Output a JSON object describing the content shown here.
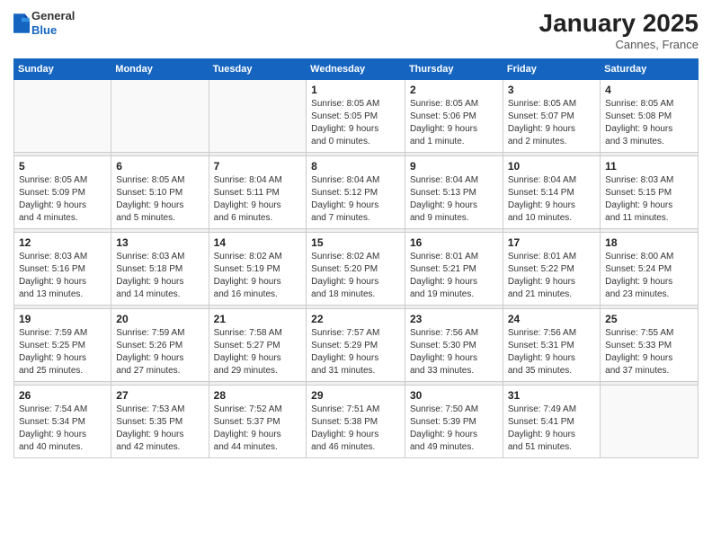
{
  "header": {
    "logo": {
      "general": "General",
      "blue": "Blue"
    },
    "title": "January 2025",
    "location": "Cannes, France"
  },
  "weekdays": [
    "Sunday",
    "Monday",
    "Tuesday",
    "Wednesday",
    "Thursday",
    "Friday",
    "Saturday"
  ],
  "weeks": [
    {
      "days": [
        {
          "number": "",
          "info": ""
        },
        {
          "number": "",
          "info": ""
        },
        {
          "number": "",
          "info": ""
        },
        {
          "number": "1",
          "info": "Sunrise: 8:05 AM\nSunset: 5:05 PM\nDaylight: 9 hours\nand 0 minutes."
        },
        {
          "number": "2",
          "info": "Sunrise: 8:05 AM\nSunset: 5:06 PM\nDaylight: 9 hours\nand 1 minute."
        },
        {
          "number": "3",
          "info": "Sunrise: 8:05 AM\nSunset: 5:07 PM\nDaylight: 9 hours\nand 2 minutes."
        },
        {
          "number": "4",
          "info": "Sunrise: 8:05 AM\nSunset: 5:08 PM\nDaylight: 9 hours\nand 3 minutes."
        }
      ]
    },
    {
      "days": [
        {
          "number": "5",
          "info": "Sunrise: 8:05 AM\nSunset: 5:09 PM\nDaylight: 9 hours\nand 4 minutes."
        },
        {
          "number": "6",
          "info": "Sunrise: 8:05 AM\nSunset: 5:10 PM\nDaylight: 9 hours\nand 5 minutes."
        },
        {
          "number": "7",
          "info": "Sunrise: 8:04 AM\nSunset: 5:11 PM\nDaylight: 9 hours\nand 6 minutes."
        },
        {
          "number": "8",
          "info": "Sunrise: 8:04 AM\nSunset: 5:12 PM\nDaylight: 9 hours\nand 7 minutes."
        },
        {
          "number": "9",
          "info": "Sunrise: 8:04 AM\nSunset: 5:13 PM\nDaylight: 9 hours\nand 9 minutes."
        },
        {
          "number": "10",
          "info": "Sunrise: 8:04 AM\nSunset: 5:14 PM\nDaylight: 9 hours\nand 10 minutes."
        },
        {
          "number": "11",
          "info": "Sunrise: 8:03 AM\nSunset: 5:15 PM\nDaylight: 9 hours\nand 11 minutes."
        }
      ]
    },
    {
      "days": [
        {
          "number": "12",
          "info": "Sunrise: 8:03 AM\nSunset: 5:16 PM\nDaylight: 9 hours\nand 13 minutes."
        },
        {
          "number": "13",
          "info": "Sunrise: 8:03 AM\nSunset: 5:18 PM\nDaylight: 9 hours\nand 14 minutes."
        },
        {
          "number": "14",
          "info": "Sunrise: 8:02 AM\nSunset: 5:19 PM\nDaylight: 9 hours\nand 16 minutes."
        },
        {
          "number": "15",
          "info": "Sunrise: 8:02 AM\nSunset: 5:20 PM\nDaylight: 9 hours\nand 18 minutes."
        },
        {
          "number": "16",
          "info": "Sunrise: 8:01 AM\nSunset: 5:21 PM\nDaylight: 9 hours\nand 19 minutes."
        },
        {
          "number": "17",
          "info": "Sunrise: 8:01 AM\nSunset: 5:22 PM\nDaylight: 9 hours\nand 21 minutes."
        },
        {
          "number": "18",
          "info": "Sunrise: 8:00 AM\nSunset: 5:24 PM\nDaylight: 9 hours\nand 23 minutes."
        }
      ]
    },
    {
      "days": [
        {
          "number": "19",
          "info": "Sunrise: 7:59 AM\nSunset: 5:25 PM\nDaylight: 9 hours\nand 25 minutes."
        },
        {
          "number": "20",
          "info": "Sunrise: 7:59 AM\nSunset: 5:26 PM\nDaylight: 9 hours\nand 27 minutes."
        },
        {
          "number": "21",
          "info": "Sunrise: 7:58 AM\nSunset: 5:27 PM\nDaylight: 9 hours\nand 29 minutes."
        },
        {
          "number": "22",
          "info": "Sunrise: 7:57 AM\nSunset: 5:29 PM\nDaylight: 9 hours\nand 31 minutes."
        },
        {
          "number": "23",
          "info": "Sunrise: 7:56 AM\nSunset: 5:30 PM\nDaylight: 9 hours\nand 33 minutes."
        },
        {
          "number": "24",
          "info": "Sunrise: 7:56 AM\nSunset: 5:31 PM\nDaylight: 9 hours\nand 35 minutes."
        },
        {
          "number": "25",
          "info": "Sunrise: 7:55 AM\nSunset: 5:33 PM\nDaylight: 9 hours\nand 37 minutes."
        }
      ]
    },
    {
      "days": [
        {
          "number": "26",
          "info": "Sunrise: 7:54 AM\nSunset: 5:34 PM\nDaylight: 9 hours\nand 40 minutes."
        },
        {
          "number": "27",
          "info": "Sunrise: 7:53 AM\nSunset: 5:35 PM\nDaylight: 9 hours\nand 42 minutes."
        },
        {
          "number": "28",
          "info": "Sunrise: 7:52 AM\nSunset: 5:37 PM\nDaylight: 9 hours\nand 44 minutes."
        },
        {
          "number": "29",
          "info": "Sunrise: 7:51 AM\nSunset: 5:38 PM\nDaylight: 9 hours\nand 46 minutes."
        },
        {
          "number": "30",
          "info": "Sunrise: 7:50 AM\nSunset: 5:39 PM\nDaylight: 9 hours\nand 49 minutes."
        },
        {
          "number": "31",
          "info": "Sunrise: 7:49 AM\nSunset: 5:41 PM\nDaylight: 9 hours\nand 51 minutes."
        },
        {
          "number": "",
          "info": ""
        }
      ]
    }
  ]
}
